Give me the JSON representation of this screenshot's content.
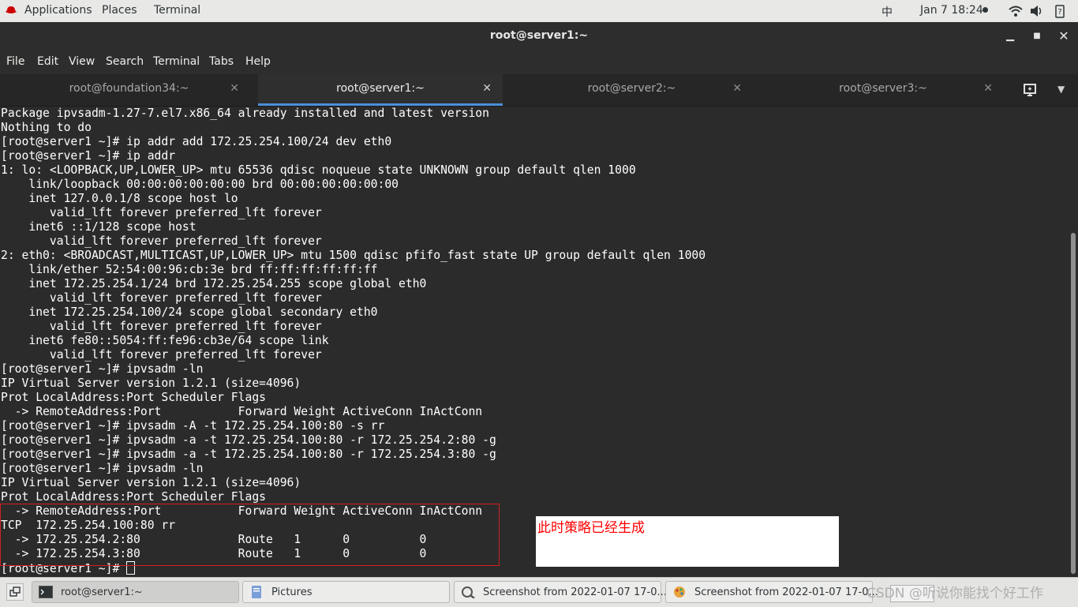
{
  "topbar": {
    "applications": "Applications",
    "places": "Places",
    "terminal": "Terminal",
    "input_method": "中",
    "clock": "Jan 7  18:24",
    "icons": [
      "wifi-icon",
      "volume-icon",
      "power-icon"
    ]
  },
  "window": {
    "title": "root@server1:~"
  },
  "menu": [
    "File",
    "Edit",
    "View",
    "Search",
    "Terminal",
    "Tabs",
    "Help"
  ],
  "tabs": [
    {
      "label": "root@foundation34:~",
      "active": false
    },
    {
      "label": "root@server1:~",
      "active": true
    },
    {
      "label": "root@server2:~",
      "active": false
    },
    {
      "label": "root@server3:~",
      "active": false
    }
  ],
  "terminal_lines": [
    "Package ipvsadm-1.27-7.el7.x86_64 already installed and latest version",
    "Nothing to do",
    "[root@server1 ~]# ip addr add 172.25.254.100/24 dev eth0",
    "[root@server1 ~]# ip addr",
    "1: lo: <LOOPBACK,UP,LOWER_UP> mtu 65536 qdisc noqueue state UNKNOWN group default qlen 1000",
    "    link/loopback 00:00:00:00:00:00 brd 00:00:00:00:00:00",
    "    inet 127.0.0.1/8 scope host lo",
    "       valid_lft forever preferred_lft forever",
    "    inet6 ::1/128 scope host",
    "       valid_lft forever preferred_lft forever",
    "2: eth0: <BROADCAST,MULTICAST,UP,LOWER_UP> mtu 1500 qdisc pfifo_fast state UP group default qlen 1000",
    "    link/ether 52:54:00:96:cb:3e brd ff:ff:ff:ff:ff:ff",
    "    inet 172.25.254.1/24 brd 172.25.254.255 scope global eth0",
    "       valid_lft forever preferred_lft forever",
    "    inet 172.25.254.100/24 scope global secondary eth0",
    "       valid_lft forever preferred_lft forever",
    "    inet6 fe80::5054:ff:fe96:cb3e/64 scope link",
    "       valid_lft forever preferred_lft forever",
    "[root@server1 ~]# ipvsadm -ln",
    "IP Virtual Server version 1.2.1 (size=4096)",
    "Prot LocalAddress:Port Scheduler Flags",
    "  -> RemoteAddress:Port           Forward Weight ActiveConn InActConn",
    "[root@server1 ~]# ipvsadm -A -t 172.25.254.100:80 -s rr",
    "[root@server1 ~]# ipvsadm -a -t 172.25.254.100:80 -r 172.25.254.2:80 -g",
    "[root@server1 ~]# ipvsadm -a -t 172.25.254.100:80 -r 172.25.254.3:80 -g",
    "[root@server1 ~]# ipvsadm -ln",
    "IP Virtual Server version 1.2.1 (size=4096)",
    "Prot LocalAddress:Port Scheduler Flags",
    "  -> RemoteAddress:Port           Forward Weight ActiveConn InActConn",
    "TCP  172.25.254.100:80 rr",
    "  -> 172.25.254.2:80              Route   1      0          0",
    "  -> 172.25.254.3:80              Route   1      0          0"
  ],
  "prompt": "[root@server1 ~]# ",
  "annotation": "此时策略已经生成",
  "taskbar": [
    {
      "label": "root@server1:~",
      "icon": "terminal-icon",
      "active": true
    },
    {
      "label": "Pictures",
      "icon": "folder-icon",
      "active": false
    },
    {
      "label": "Screenshot from 2022-01-07 17-0...",
      "icon": "image-viewer-icon",
      "active": false
    },
    {
      "label": "Screenshot from 2022-01-07 17-0...",
      "icon": "image-editor-icon",
      "active": false
    }
  ],
  "watermark": "CSDN @听说你能找个好工作",
  "colors": {
    "terminal_bg": "#2b2b2b",
    "tab_accent": "#4a90d9",
    "annotation_border": "#d02020",
    "annotation_text": "#ff0000"
  }
}
